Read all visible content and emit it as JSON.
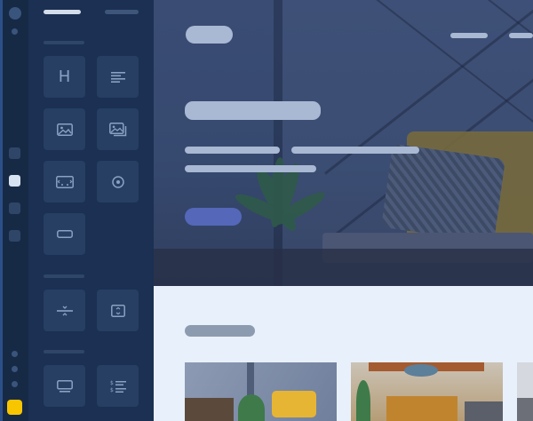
{
  "app": {
    "window": "page-builder-editor"
  },
  "rail": {
    "icons": [
      "app-icon",
      "nav-dot",
      "layout-square",
      "element-square",
      "page-square",
      "style-square",
      "menu-dot",
      "menu-dot",
      "menu-dot",
      "brand-square"
    ],
    "active_index": 1,
    "brand_color": "#f7c600"
  },
  "panel": {
    "tabs": [
      "elements-tab",
      "layers-tab"
    ],
    "tiles": [
      {
        "icon": "heading-icon",
        "glyph": "H"
      },
      {
        "icon": "text-icon"
      },
      {
        "icon": "image-icon"
      },
      {
        "icon": "gallery-icon"
      },
      {
        "icon": "slider-icon"
      },
      {
        "icon": "video-icon"
      },
      {
        "icon": "button-icon"
      },
      {
        "icon": "divider-icon"
      },
      {
        "icon": "spacer-icon"
      },
      {
        "icon": "card-icon"
      },
      {
        "icon": "price-list-icon"
      }
    ]
  },
  "colors": {
    "accent": "#5567b8",
    "panel_bg": "#1b3052",
    "content_bg": "#e8f0fb"
  }
}
